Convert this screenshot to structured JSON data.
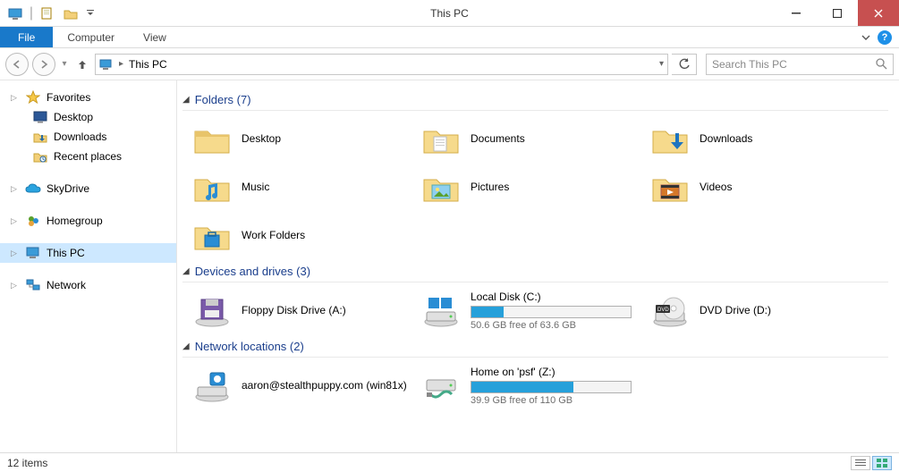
{
  "window": {
    "title": "This PC"
  },
  "ribbon": {
    "file": "File",
    "tabs": [
      "Computer",
      "View"
    ]
  },
  "address": {
    "crumb": "This PC"
  },
  "search": {
    "placeholder": "Search This PC"
  },
  "navpane": {
    "favorites": {
      "label": "Favorites",
      "items": [
        "Desktop",
        "Downloads",
        "Recent places"
      ]
    },
    "skydrive": {
      "label": "SkyDrive"
    },
    "homegroup": {
      "label": "Homegroup"
    },
    "thispc": {
      "label": "This PC"
    },
    "network": {
      "label": "Network"
    }
  },
  "sections": {
    "folders": {
      "title": "Folders (7)",
      "items": [
        "Desktop",
        "Documents",
        "Downloads",
        "Music",
        "Pictures",
        "Videos",
        "Work Folders"
      ]
    },
    "drives": {
      "title": "Devices and drives (3)",
      "items": [
        {
          "label": "Floppy Disk Drive (A:)"
        },
        {
          "label": "Local Disk (C:)",
          "sub": "50.6 GB free of 63.6 GB",
          "fill": 20
        },
        {
          "label": "DVD Drive (D:)"
        }
      ]
    },
    "network": {
      "title": "Network locations (2)",
      "items": [
        {
          "label": "aaron@stealthpuppy.com (win81x)"
        },
        {
          "label": "Home on 'psf' (Z:)",
          "sub": "39.9 GB free of 110 GB",
          "fill": 64
        }
      ]
    }
  },
  "status": {
    "text": "12 items"
  }
}
